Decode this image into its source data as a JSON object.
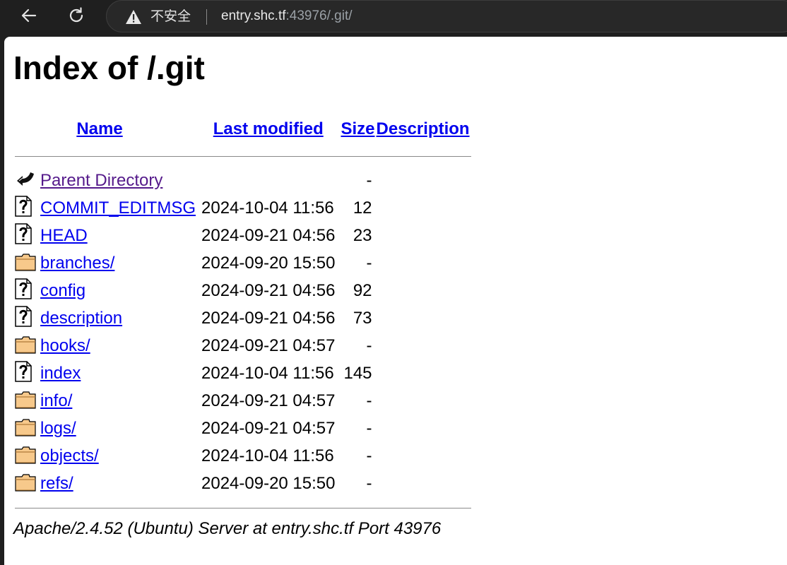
{
  "browser": {
    "security_label": "不安全",
    "url_host": "entry.shc.tf",
    "url_rest": ":43976/.git/"
  },
  "page": {
    "title": "Index of /.git",
    "headers": {
      "name": "Name",
      "last_modified": "Last modified",
      "size": "Size",
      "description": "Description"
    },
    "rows": [
      {
        "icon": "back-icon",
        "name": "Parent Directory",
        "date": "",
        "size": "-",
        "visited": true
      },
      {
        "icon": "unknown-file-icon",
        "name": "COMMIT_EDITMSG",
        "date": "2024-10-04 11:56",
        "size": "12"
      },
      {
        "icon": "unknown-file-icon",
        "name": "HEAD",
        "date": "2024-09-21 04:56",
        "size": "23"
      },
      {
        "icon": "folder-icon",
        "name": "branches/",
        "date": "2024-09-20 15:50",
        "size": "-"
      },
      {
        "icon": "unknown-file-icon",
        "name": "config",
        "date": "2024-09-21 04:56",
        "size": "92"
      },
      {
        "icon": "unknown-file-icon",
        "name": "description",
        "date": "2024-09-21 04:56",
        "size": "73"
      },
      {
        "icon": "folder-icon",
        "name": "hooks/",
        "date": "2024-09-21 04:57",
        "size": "-"
      },
      {
        "icon": "unknown-file-icon",
        "name": "index",
        "date": "2024-10-04 11:56",
        "size": "145"
      },
      {
        "icon": "folder-icon",
        "name": "info/",
        "date": "2024-09-21 04:57",
        "size": "-"
      },
      {
        "icon": "folder-icon",
        "name": "logs/",
        "date": "2024-09-21 04:57",
        "size": "-"
      },
      {
        "icon": "folder-icon",
        "name": "objects/",
        "date": "2024-10-04 11:56",
        "size": "-"
      },
      {
        "icon": "folder-icon",
        "name": "refs/",
        "date": "2024-09-20 15:50",
        "size": "-"
      }
    ],
    "footer": "Apache/2.4.52 (Ubuntu) Server at entry.shc.tf Port 43976"
  },
  "colors": {
    "link": "#0000ee",
    "visited_link": "#551a8b",
    "chrome_bg": "#1f1f1f"
  }
}
